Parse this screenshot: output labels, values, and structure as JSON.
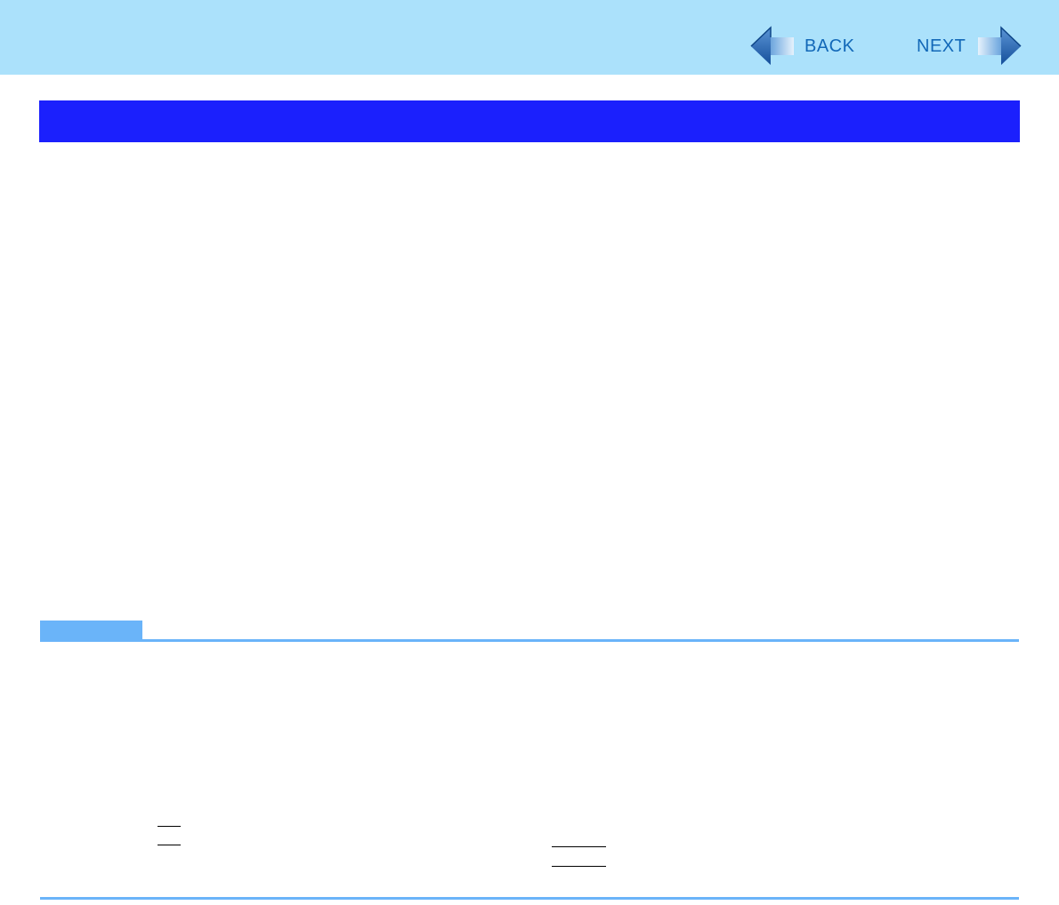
{
  "nav": {
    "back_label": "BACK",
    "next_label": "NEXT"
  },
  "title_bar": {
    "title": ""
  },
  "note": {
    "label": ""
  },
  "icons": {
    "back": "left-arrow-icon",
    "next": "right-arrow-icon"
  },
  "colors": {
    "header_band": "#abe1fb",
    "title_bar": "#1b20fd",
    "note_accent": "#6ab4f9",
    "nav_text": "#1268b8"
  }
}
